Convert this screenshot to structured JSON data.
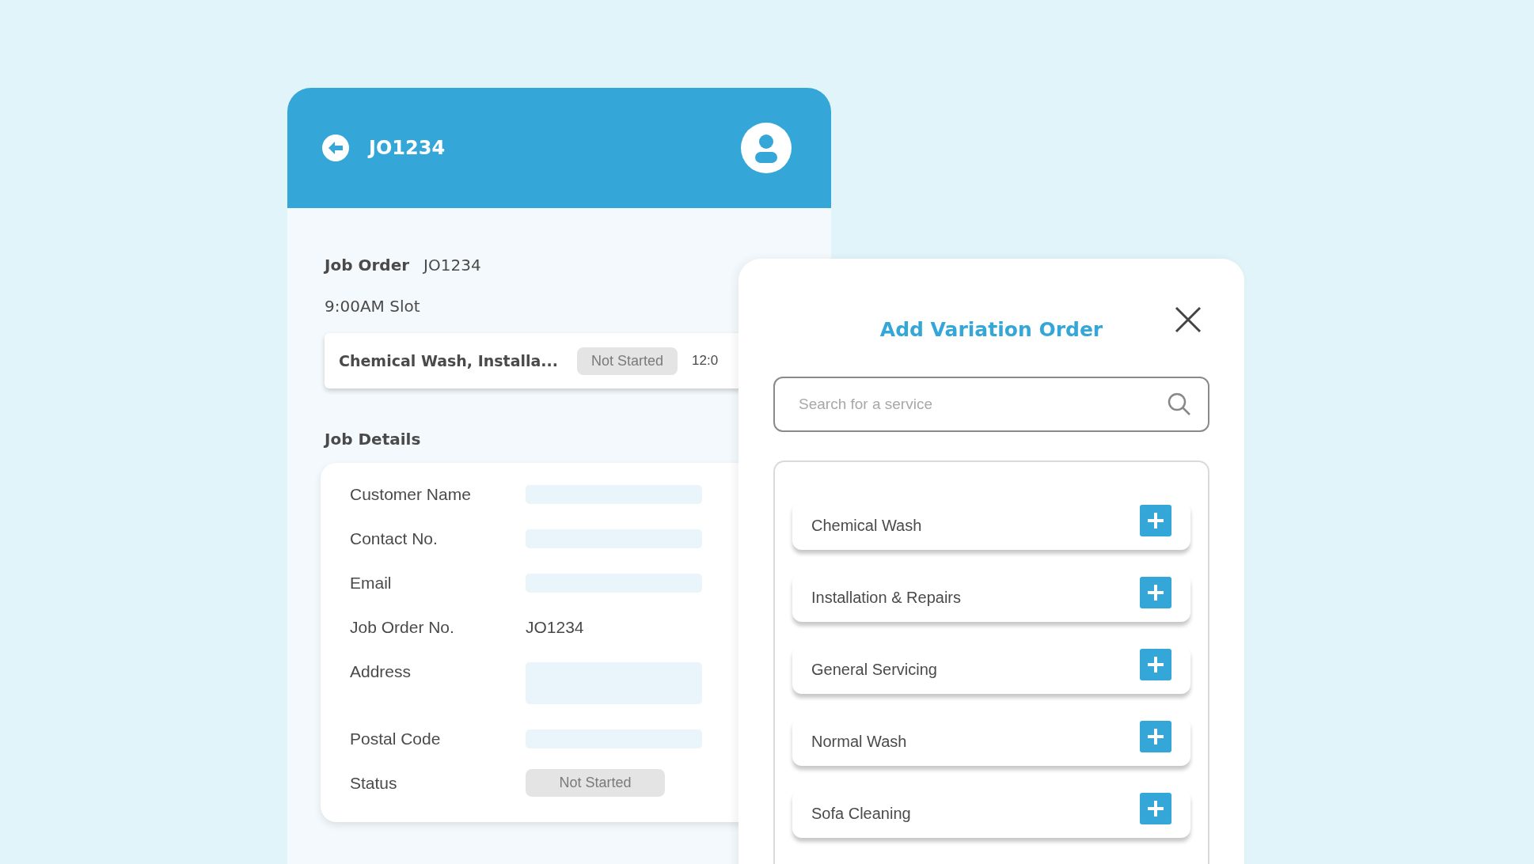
{
  "header": {
    "title": "JO1234"
  },
  "job_order": {
    "label": "Job Order",
    "value": "JO1234"
  },
  "slot": "9:00AM Slot",
  "job_card": {
    "title": "Chemical Wash, Installa...",
    "status": "Not Started",
    "time": "12:0"
  },
  "job_details": {
    "title": "Job Details",
    "fields": [
      {
        "label": "Customer Name",
        "kind": "blank"
      },
      {
        "label": "Contact No.",
        "kind": "blank"
      },
      {
        "label": "Email",
        "kind": "blank"
      },
      {
        "label": "Job Order No.",
        "kind": "text",
        "value": "JO1234"
      },
      {
        "label": "Address",
        "kind": "blank-tall"
      },
      {
        "label": "Postal Code",
        "kind": "blank"
      },
      {
        "label": "Status",
        "kind": "badge",
        "value": "Not Started"
      }
    ]
  },
  "modal": {
    "title": "Add Variation Order",
    "search": {
      "placeholder": "Search for a service"
    },
    "services": [
      {
        "label": "Chemical Wash"
      },
      {
        "label": "Installation & Repairs"
      },
      {
        "label": "General Servicing"
      },
      {
        "label": "Normal Wash"
      },
      {
        "label": "Sofa Cleaning"
      }
    ]
  }
}
